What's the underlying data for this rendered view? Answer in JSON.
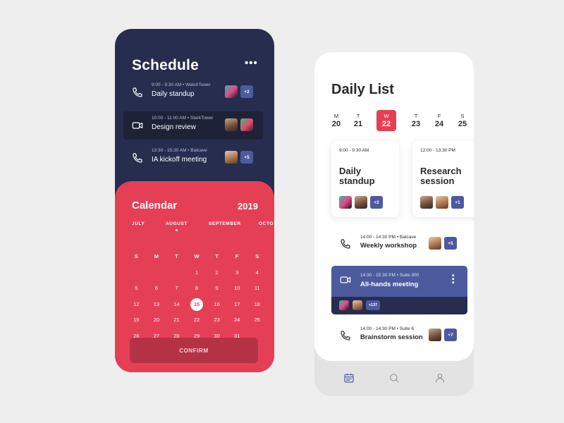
{
  "schedule": {
    "title": "Schedule",
    "more_label": "•••",
    "events": [
      {
        "time": "9:00 - 9:30 AM • WatchTower",
        "name": "Daily standup",
        "icon": "phone-icon",
        "extra": "+2"
      },
      {
        "time": "10:00 - 11:00 AM • StarkTower",
        "name": "Design review",
        "icon": "video-icon",
        "extra": ""
      },
      {
        "time": "13:30 - 15:30 AM • Batcave",
        "name": "IA kickoff meeting",
        "icon": "phone-icon",
        "extra": "+5"
      }
    ]
  },
  "calendar": {
    "title": "Calendar",
    "year": "2019",
    "months": [
      "JULY",
      "AUGUST",
      "SEPTEMBER",
      "OCTO"
    ],
    "selected_month": "AUGUST",
    "weekday_headers": [
      "S",
      "M",
      "T",
      "W",
      "T",
      "F",
      "S"
    ],
    "weeks": [
      [
        "",
        "",
        "",
        "1",
        "2",
        "3",
        "4"
      ],
      [
        "5",
        "6",
        "7",
        "8",
        "9",
        "10",
        "11"
      ],
      [
        "12",
        "13",
        "14",
        "15",
        "16",
        "17",
        "18"
      ],
      [
        "19",
        "20",
        "21",
        "22",
        "23",
        "24",
        "25"
      ],
      [
        "26",
        "27",
        "28",
        "29",
        "30",
        "31",
        ""
      ]
    ],
    "selected_day": "15",
    "confirm_label": "CONFIRM"
  },
  "daily_list": {
    "title": "Daily List",
    "week": [
      {
        "letter": "M",
        "day": "20"
      },
      {
        "letter": "T",
        "day": "21"
      },
      {
        "letter": "W",
        "day": "22"
      },
      {
        "letter": "T",
        "day": "23"
      },
      {
        "letter": "F",
        "day": "24"
      },
      {
        "letter": "S",
        "day": "25"
      }
    ],
    "selected_day": "22",
    "cards": [
      {
        "time": "9:00 - 9:30 AM",
        "name": "Daily standup",
        "extra": "+2"
      },
      {
        "time": "12:00 - 13:30 PM",
        "name": "Research session",
        "extra": "+1"
      }
    ],
    "events": [
      {
        "time": "14:00 - 14:30 PM • Batcave",
        "name": "Weekly workshop",
        "icon": "phone-icon",
        "extra": "+5"
      },
      {
        "time": "14:30 - 15:30 PM • Suite 300",
        "name": "All-hands meeting",
        "icon": "video-icon",
        "extra": "+137"
      },
      {
        "time": "14:00 - 14:30 PM • Suite 6",
        "name": "Brainstorm session",
        "icon": "phone-icon",
        "extra": "+7"
      }
    ],
    "nav": [
      "calendar-icon",
      "search-icon",
      "profile-icon"
    ]
  },
  "colors": {
    "navy": "#262d4f",
    "navy_dark": "#1d2237",
    "coral": "#e53f56",
    "indigo": "#4d5a9e",
    "background": "#eeeeee"
  }
}
